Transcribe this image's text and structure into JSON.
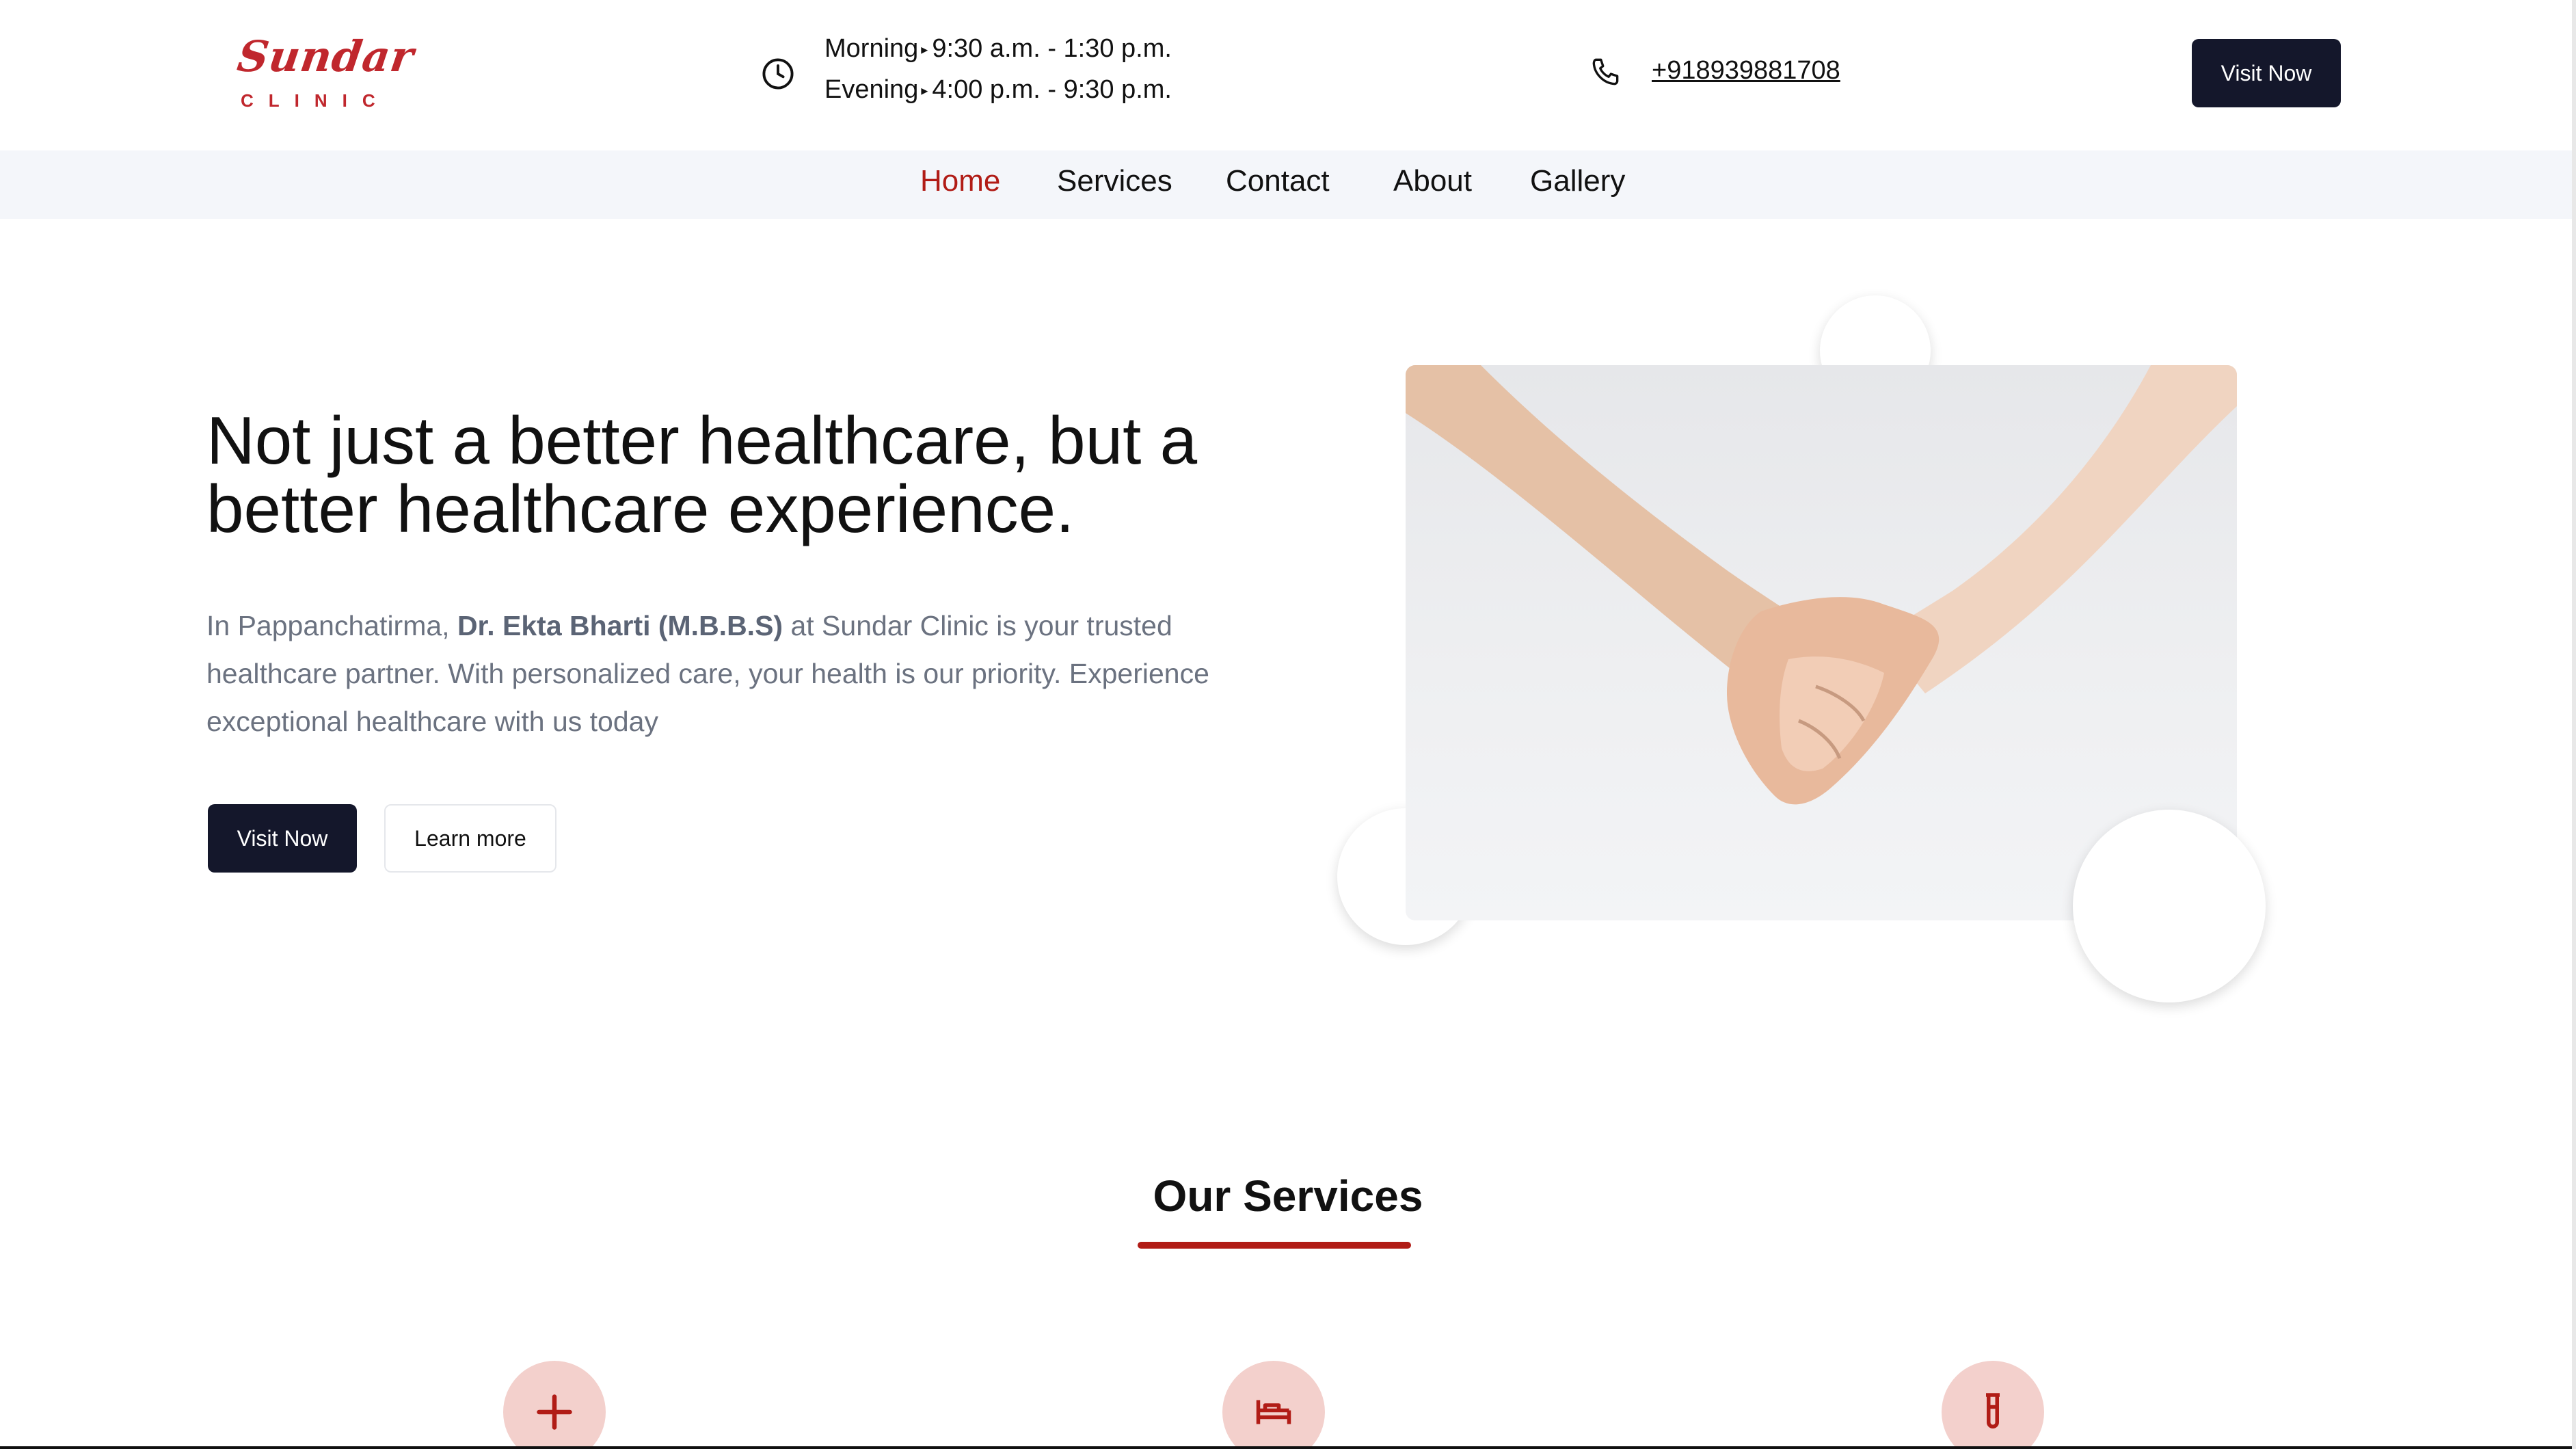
{
  "header": {
    "logo": {
      "word": "Sundar",
      "sub": "CLINIC"
    },
    "hours": {
      "morning_label": "Morning",
      "morning_time": "9:30 a.m. - 1:30 p.m.",
      "evening_label": "Evening",
      "evening_time": "4:00 p.m. - 9:30 p.m."
    },
    "phone": "+918939881708",
    "visit_label": "Visit Now"
  },
  "nav": {
    "items": [
      {
        "label": "Home",
        "active": true
      },
      {
        "label": "Services"
      },
      {
        "label": "Contact"
      },
      {
        "label": "About"
      },
      {
        "label": "Gallery"
      }
    ]
  },
  "hero": {
    "title": "Not just a better healthcare, but a better healthcare experience.",
    "desc_prefix": "In Pappanchatirma, ",
    "desc_bold": "Dr. Ekta Bharti (M.B.B.S)",
    "desc_suffix": " at Sundar Clinic is your trusted healthcare partner. With personalized care, your health is our priority. Experience exceptional healthcare with us today",
    "visit_label": "Visit Now",
    "learn_label": "Learn more"
  },
  "services": {
    "title": "Our Services",
    "icons": [
      "plus-icon",
      "bed-icon",
      "test-tube-icon"
    ]
  },
  "colors": {
    "accent": "#b11c16",
    "dark_button": "#14172b",
    "logo": "#c0272d",
    "icon_circle": "#f3d0cc",
    "nav_bg": "#f4f6fa"
  }
}
